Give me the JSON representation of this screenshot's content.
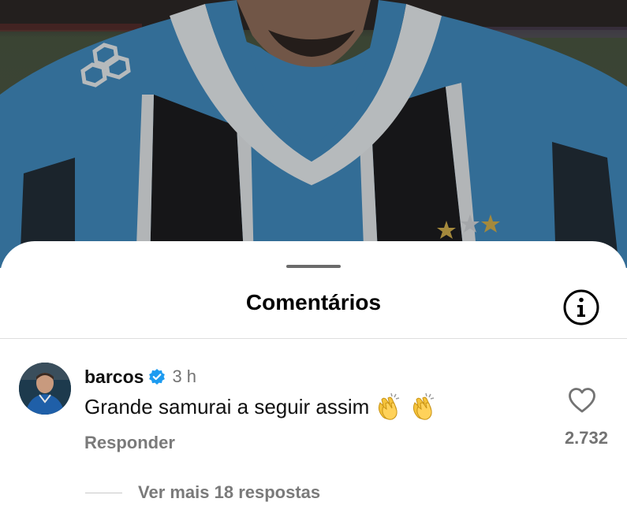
{
  "sheet": {
    "title": "Comentários",
    "info_icon": "info-circle-icon"
  },
  "comment": {
    "username": "barcos",
    "verified_icon": "verified-badge-icon",
    "time": "3 h",
    "text": "Grande samurai a seguir assim",
    "emoji": [
      "clapping-hands-icon",
      "clapping-hands-icon"
    ],
    "reply_label": "Responder",
    "like_icon": "heart-outline-icon",
    "like_count": "2.732",
    "more_replies_label": "Ver mais 18 respostas"
  },
  "colors": {
    "accent_verified": "#1d9bf0",
    "secondary_text": "#737373",
    "jersey_blue": "#3f86b8",
    "jersey_black": "#1c1c1e"
  }
}
